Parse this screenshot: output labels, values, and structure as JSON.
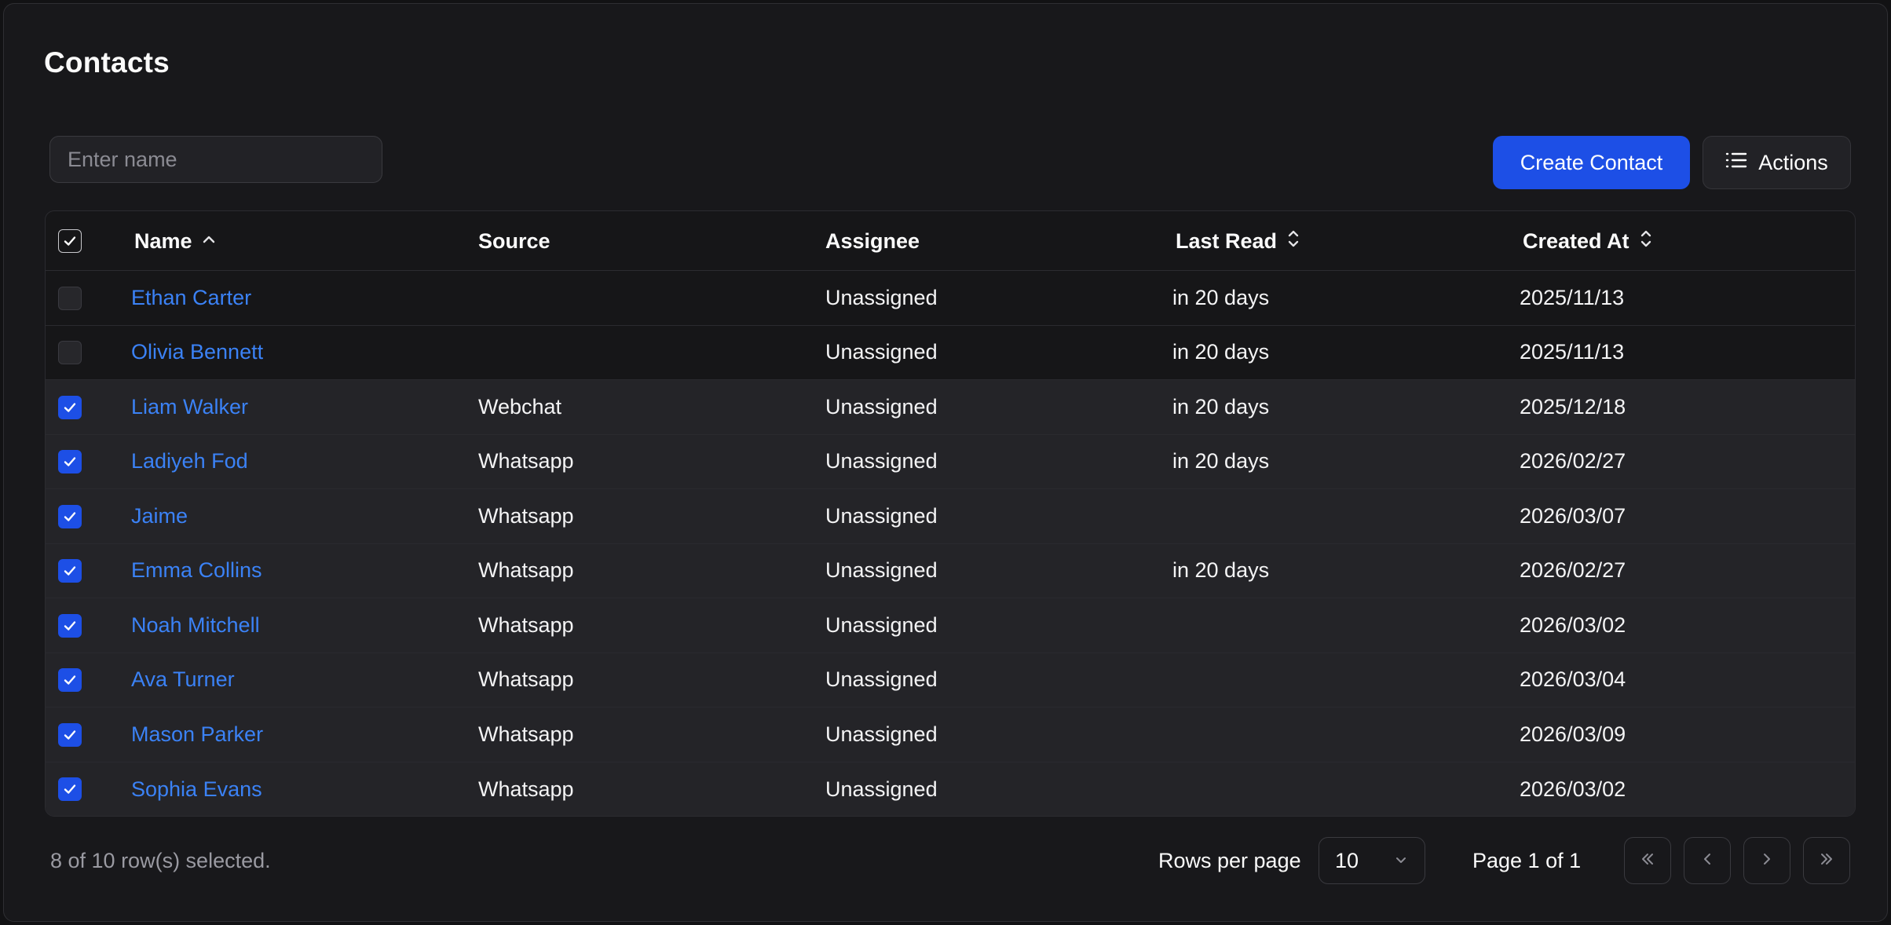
{
  "page": {
    "title": "Contacts"
  },
  "search": {
    "placeholder": "Enter name",
    "value": ""
  },
  "toolbar": {
    "create_label": "Create Contact",
    "actions_label": "Actions"
  },
  "table": {
    "columns": [
      {
        "label": "Name",
        "sort": "ascending",
        "icon": "chevron-up-icon"
      },
      {
        "label": "Source"
      },
      {
        "label": "Assignee"
      },
      {
        "label": "Last Read",
        "sort": "none",
        "icon": "sort-icon"
      },
      {
        "label": "Created At",
        "sort": "none",
        "icon": "sort-icon"
      }
    ],
    "header_checkbox": "checked",
    "rows": [
      {
        "selected": false,
        "name": "Ethan Carter",
        "source": "",
        "assignee": "Unassigned",
        "last_read": "in 20 days",
        "created_at": "2025/11/13"
      },
      {
        "selected": false,
        "name": "Olivia Bennett",
        "source": "",
        "assignee": "Unassigned",
        "last_read": "in 20 days",
        "created_at": "2025/11/13"
      },
      {
        "selected": true,
        "name": "Liam Walker",
        "source": "Webchat",
        "assignee": "Unassigned",
        "last_read": "in 20 days",
        "created_at": "2025/12/18"
      },
      {
        "selected": true,
        "name": "Ladiyeh Fod",
        "source": "Whatsapp",
        "assignee": "Unassigned",
        "last_read": "in 20 days",
        "created_at": "2026/02/27"
      },
      {
        "selected": true,
        "name": "Jaime",
        "source": "Whatsapp",
        "assignee": "Unassigned",
        "last_read": "",
        "created_at": "2026/03/07"
      },
      {
        "selected": true,
        "name": "Emma Collins",
        "source": "Whatsapp",
        "assignee": "Unassigned",
        "last_read": "in 20 days",
        "created_at": "2026/02/27"
      },
      {
        "selected": true,
        "name": "Noah Mitchell",
        "source": "Whatsapp",
        "assignee": "Unassigned",
        "last_read": "",
        "created_at": "2026/03/02"
      },
      {
        "selected": true,
        "name": "Ava Turner",
        "source": "Whatsapp",
        "assignee": "Unassigned",
        "last_read": "",
        "created_at": "2026/03/04"
      },
      {
        "selected": true,
        "name": "Mason Parker",
        "source": "Whatsapp",
        "assignee": "Unassigned",
        "last_read": "",
        "created_at": "2026/03/09"
      },
      {
        "selected": true,
        "name": "Sophia Evans",
        "source": "Whatsapp",
        "assignee": "Unassigned",
        "last_read": "",
        "created_at": "2026/03/02"
      }
    ]
  },
  "footer": {
    "selection_text": "8 of 10 row(s) selected.",
    "rows_per_page_label": "Rows per page",
    "rows_per_page_value": "10",
    "page_text": "Page 1 of 1"
  },
  "colors": {
    "accent": "#1d4fe6",
    "link": "#3b82f6",
    "background": "#18181b"
  }
}
